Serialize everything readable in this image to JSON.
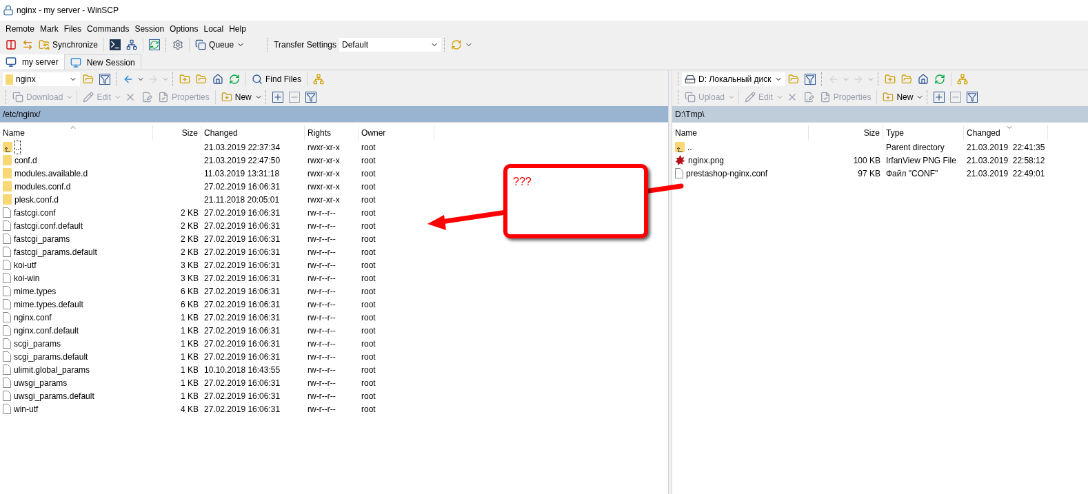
{
  "window": {
    "title": "nginx - my server - WinSCP"
  },
  "menu": [
    "Remote",
    "Mark",
    "Files",
    "Commands",
    "Session",
    "Options",
    "Local",
    "Help"
  ],
  "toolbar": {
    "synchronize": "Synchronize",
    "queue": "Queue",
    "transfer_settings_label": "Transfer Settings",
    "transfer_settings_value": "Default"
  },
  "tabs": [
    {
      "label": "my server",
      "selected": true,
      "kind": "session"
    },
    {
      "label": "New Session",
      "selected": false,
      "kind": "new"
    }
  ],
  "left_panel": {
    "active": true,
    "location": "nginx",
    "find_files": "Find Files",
    "actions": [
      {
        "label": "Download",
        "disabled": true,
        "kind": "transfer"
      },
      {
        "label": "Edit",
        "disabled": true,
        "kind": "edit"
      },
      {
        "label": "Properties",
        "disabled": true,
        "kind": "properties"
      },
      {
        "label": "New",
        "disabled": false,
        "kind": "new"
      }
    ],
    "path": "/etc/nginx/",
    "sort_descending": false,
    "columns": [
      {
        "label": "Name",
        "sorted": true
      },
      {
        "label": "Size",
        "sorted": false
      },
      {
        "label": "Changed",
        "sorted": false
      },
      {
        "label": "Rights",
        "sorted": false
      },
      {
        "label": "Owner",
        "sorted": false
      }
    ],
    "rows": [
      {
        "kind": "parent",
        "name": "..",
        "size": "",
        "changed": "21.03.2019 22:37:34",
        "rights": "rwxr-xr-x",
        "owner": "root",
        "focused": true
      },
      {
        "kind": "folder",
        "name": "conf.d",
        "size": "",
        "changed": "21.03.2019 22:47:50",
        "rights": "rwxr-xr-x",
        "owner": "root",
        "focused": false
      },
      {
        "kind": "folder",
        "name": "modules.available.d",
        "size": "",
        "changed": "11.03.2019 13:31:18",
        "rights": "rwxr-xr-x",
        "owner": "root",
        "focused": false
      },
      {
        "kind": "folder",
        "name": "modules.conf.d",
        "size": "",
        "changed": "27.02.2019 16:06:31",
        "rights": "rwxr-xr-x",
        "owner": "root",
        "focused": false
      },
      {
        "kind": "folder",
        "name": "plesk.conf.d",
        "size": "",
        "changed": "21.11.2018 20:05:01",
        "rights": "rwxr-xr-x",
        "owner": "root",
        "focused": false
      },
      {
        "kind": "file",
        "name": "fastcgi.conf",
        "size": "2 KB",
        "changed": "27.02.2019 16:06:31",
        "rights": "rw-r--r--",
        "owner": "root",
        "focused": false
      },
      {
        "kind": "file",
        "name": "fastcgi.conf.default",
        "size": "2 KB",
        "changed": "27.02.2019 16:06:31",
        "rights": "rw-r--r--",
        "owner": "root",
        "focused": false
      },
      {
        "kind": "file",
        "name": "fastcgi_params",
        "size": "2 KB",
        "changed": "27.02.2019 16:06:31",
        "rights": "rw-r--r--",
        "owner": "root",
        "focused": false
      },
      {
        "kind": "file",
        "name": "fastcgi_params.default",
        "size": "2 KB",
        "changed": "27.02.2019 16:06:31",
        "rights": "rw-r--r--",
        "owner": "root",
        "focused": false
      },
      {
        "kind": "file",
        "name": "koi-utf",
        "size": "3 KB",
        "changed": "27.02.2019 16:06:31",
        "rights": "rw-r--r--",
        "owner": "root",
        "focused": false
      },
      {
        "kind": "file",
        "name": "koi-win",
        "size": "3 KB",
        "changed": "27.02.2019 16:06:31",
        "rights": "rw-r--r--",
        "owner": "root",
        "focused": false
      },
      {
        "kind": "file",
        "name": "mime.types",
        "size": "6 KB",
        "changed": "27.02.2019 16:06:31",
        "rights": "rw-r--r--",
        "owner": "root",
        "focused": false
      },
      {
        "kind": "file",
        "name": "mime.types.default",
        "size": "6 KB",
        "changed": "27.02.2019 16:06:31",
        "rights": "rw-r--r--",
        "owner": "root",
        "focused": false
      },
      {
        "kind": "file",
        "name": "nginx.conf",
        "size": "1 KB",
        "changed": "27.02.2019 16:06:31",
        "rights": "rw-r--r--",
        "owner": "root",
        "focused": false
      },
      {
        "kind": "file",
        "name": "nginx.conf.default",
        "size": "1 KB",
        "changed": "27.02.2019 16:06:31",
        "rights": "rw-r--r--",
        "owner": "root",
        "focused": false
      },
      {
        "kind": "file",
        "name": "scgi_params",
        "size": "1 KB",
        "changed": "27.02.2019 16:06:31",
        "rights": "rw-r--r--",
        "owner": "root",
        "focused": false
      },
      {
        "kind": "file",
        "name": "scgi_params.default",
        "size": "1 KB",
        "changed": "27.02.2019 16:06:31",
        "rights": "rw-r--r--",
        "owner": "root",
        "focused": false
      },
      {
        "kind": "file",
        "name": "ulimit.global_params",
        "size": "1 KB",
        "changed": "10.10.2018 16:43:55",
        "rights": "rw-r--r--",
        "owner": "root",
        "focused": false
      },
      {
        "kind": "file",
        "name": "uwsgi_params",
        "size": "1 KB",
        "changed": "27.02.2019 16:06:31",
        "rights": "rw-r--r--",
        "owner": "root",
        "focused": false
      },
      {
        "kind": "file",
        "name": "uwsgi_params.default",
        "size": "1 KB",
        "changed": "27.02.2019 16:06:31",
        "rights": "rw-r--r--",
        "owner": "root",
        "focused": false
      },
      {
        "kind": "file",
        "name": "win-utf",
        "size": "4 KB",
        "changed": "27.02.2019 16:06:31",
        "rights": "rw-r--r--",
        "owner": "root",
        "focused": false
      }
    ]
  },
  "right_panel": {
    "active": false,
    "location": "D: Локальный диск",
    "actions": [
      {
        "label": "Upload",
        "disabled": true,
        "kind": "transfer"
      },
      {
        "label": "Edit",
        "disabled": true,
        "kind": "edit"
      },
      {
        "label": "Properties",
        "disabled": true,
        "kind": "properties"
      },
      {
        "label": "New",
        "disabled": false,
        "kind": "new"
      }
    ],
    "path": "D:\\Tmp\\",
    "sort_descending": true,
    "columns": [
      {
        "label": "Name",
        "sorted": false
      },
      {
        "label": "Size",
        "sorted": false
      },
      {
        "label": "Type",
        "sorted": false
      },
      {
        "label": "Changed",
        "sorted": true
      }
    ],
    "rows": [
      {
        "kind": "parent",
        "name": "..",
        "size": "",
        "type": "Parent directory",
        "changed": "21.03.2019  22:41:35"
      },
      {
        "kind": "image",
        "name": "nginx.png",
        "size": "100 KB",
        "type": "IrfanView PNG File",
        "changed": "21.03.2019  22:58:12"
      },
      {
        "kind": "file",
        "name": "prestashop-nginx.conf",
        "size": "97 KB",
        "type": "Файл \"CONF\"",
        "changed": "21.03.2019  22:49:01"
      }
    ]
  },
  "annotation": {
    "text": "???"
  }
}
